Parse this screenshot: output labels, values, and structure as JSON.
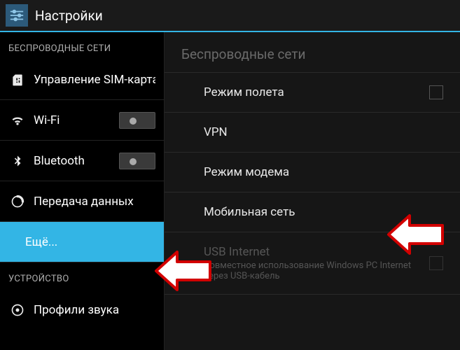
{
  "header": {
    "title": "Настройки"
  },
  "sidebar": {
    "sections": [
      {
        "label": "БЕСПРОВОДНЫЕ СЕТИ",
        "items": [
          {
            "id": "sim",
            "label": "Управление SIM-картам"
          },
          {
            "id": "wifi",
            "label": "Wi-Fi"
          },
          {
            "id": "bt",
            "label": "Bluetooth"
          },
          {
            "id": "data",
            "label": "Передача данных"
          },
          {
            "id": "more",
            "label": "Ещё..."
          }
        ]
      },
      {
        "label": "УСТРОЙСТВО",
        "items": [
          {
            "id": "sound",
            "label": "Профили звука"
          }
        ]
      }
    ]
  },
  "content": {
    "header": "Беспроводные сети",
    "items": [
      {
        "id": "airplane",
        "label": "Режим полета"
      },
      {
        "id": "vpn",
        "label": "VPN"
      },
      {
        "id": "tether",
        "label": "Режим модема"
      },
      {
        "id": "mobile",
        "label": "Мобильная сеть"
      },
      {
        "id": "usbnet",
        "label": "USB Internet",
        "sub": "Совместное использование Windows PC Internet через USB-кабель"
      }
    ]
  },
  "colors": {
    "accent": "#33b5e5",
    "arrow_outline": "#d20000",
    "arrow_fill": "#ffffff"
  }
}
